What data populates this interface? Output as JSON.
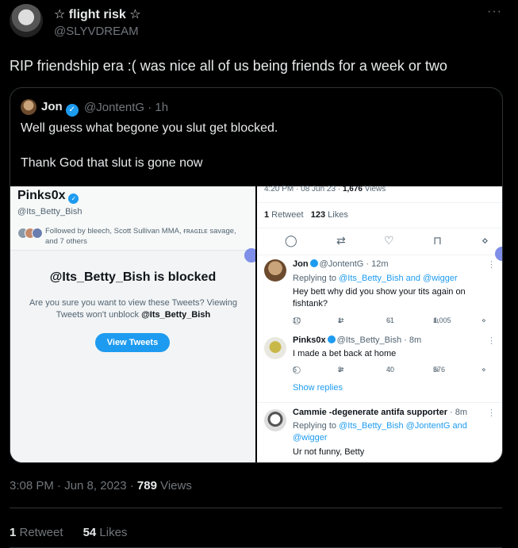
{
  "author": {
    "name": "☆ flight risk ☆",
    "handle": "@SLYVDREAM",
    "more_icon": "···"
  },
  "tweet": {
    "text": "RIP friendship era :( was nice all of us being friends for a week or two",
    "timestamp": "3:08 PM · Jun 8, 2023 · ",
    "views_count": "789",
    "views_label": " Views",
    "retweets_count": "1",
    "retweets_label": " Retweet",
    "likes_count": "54",
    "likes_label": " Likes"
  },
  "quote": {
    "name": "Jon",
    "handle": "@JontentG · 1h",
    "text1": "Well guess what begone you slut get blocked.",
    "text2": "Thank God that slut is gone now"
  },
  "left_shot": {
    "name": "Pinks0x",
    "handle": "@Its_Betty_Bish",
    "followed_by": "Followed by bleech, Scott Sullivan MMA, ғʀᴀɢɪʟᴇ savage, and 7 others",
    "blocked_title": "@Its_Betty_Bish is blocked",
    "blocked_sub": "Are you sure you want to view these Tweets? Viewing Tweets won't unblock ",
    "blocked_sub_handle": "@Its_Betty_Bish",
    "view_button": "View Tweets"
  },
  "right_shot": {
    "meta_prefix": "4:20 PM · 08 Jun 23 · ",
    "meta_views": "1,676",
    "meta_views_label": " Views",
    "retweets_count": "1",
    "retweets_label": " Retweet",
    "likes_count": "123",
    "likes_label": " Likes",
    "replies": [
      {
        "name": "Jon",
        "meta": "@JontentG · 12m",
        "replying_prefix": "Replying to ",
        "replying_mentions": "@Its_Betty_Bish and @wigger",
        "text": "Hey bett why did you show your tits again on fishtank?",
        "comments": "10",
        "retweets": "1",
        "likes": "61",
        "views": "1,005"
      },
      {
        "name": "Pinks0x",
        "meta": "@Its_Betty_Bish · 8m",
        "text": "I made a bet back at home",
        "comments": "6",
        "retweets": "3",
        "likes": "40",
        "views": "576",
        "show_replies": "Show replies"
      },
      {
        "name": "Cammie -degenerate antifa supporter",
        "meta": " · 8m",
        "replying_prefix": "Replying to ",
        "replying_mentions": "@Its_Betty_Bish @JontentG and @wigger",
        "text": "Ur not funny, Betty"
      }
    ]
  },
  "colors": {
    "background": "#000000",
    "text": "#e7e9ea",
    "muted": "#71767b",
    "accent": "#1d9bf0"
  }
}
